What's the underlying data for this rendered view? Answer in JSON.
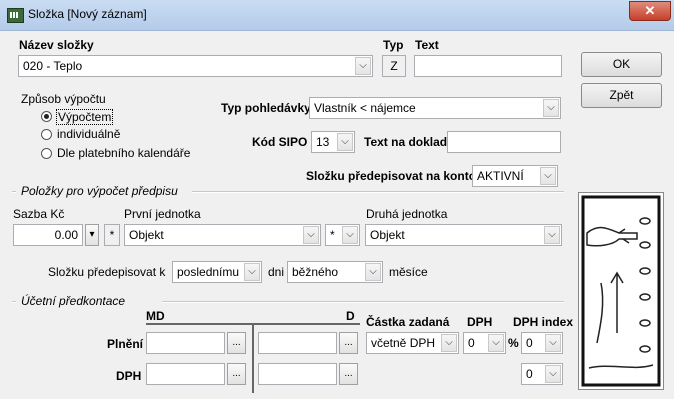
{
  "window": {
    "title": "Složka  [Nový záznam]",
    "close_glyph": "✕"
  },
  "labels": {
    "nazev_slozky": "Název složky",
    "typ": "Typ",
    "text": "Text",
    "zpusob_vypoctu": "Způsob výpočtu",
    "typ_pohledavky": "Typ pohledávky",
    "kod_sipo": "Kód SIPO",
    "text_na_doklad": "Text na doklad",
    "slozku_na_konto": "Složku předepisovat na konto",
    "polozky_group": "Položky pro výpočet předpisu",
    "sazba_kc": "Sazba Kč",
    "prvni_jednotka": "První jednotka",
    "druha_jednotka": "Druhá jednotka",
    "slozku_predepisovat_k": "Složku předepisovat k",
    "dni": "dni",
    "mesice": "měsíce",
    "ucetni_group": "Účetní předkontace",
    "md": "MD",
    "d": "D",
    "castka_zadana": "Částka zadaná",
    "dph": "DPH",
    "dph_index": "DPH index",
    "plneni": "Plnění",
    "dph_row": "DPH",
    "percent": "%"
  },
  "fields": {
    "nazev_slozky": "020 - Teplo",
    "typ": "Z",
    "text": "",
    "typ_pohledavky": "Vlastník < nájemce",
    "kod_sipo": "13",
    "text_na_doklad": "",
    "konto": "AKTIVNÍ",
    "sazba": "0.00",
    "op1": "*",
    "prvni_jednotka": "Objekt",
    "op2": "*",
    "druha_jednotka": "Objekt",
    "predepisovat_k": "poslednímu",
    "dni": "běžného",
    "castka_zadana": "včetně DPH",
    "dph": "0",
    "dph_index_1": "0",
    "dph_index_2": "0"
  },
  "radios": [
    {
      "label": "Výpočtem",
      "checked": true
    },
    {
      "label": "individuálně",
      "checked": false
    },
    {
      "label": "Dle platebního kalendáře",
      "checked": false
    }
  ],
  "buttons": {
    "ok": "OK",
    "zpet": "Zpět",
    "ellipsis": "...",
    "combo": "⌵",
    "sazba_drop": "▾"
  }
}
